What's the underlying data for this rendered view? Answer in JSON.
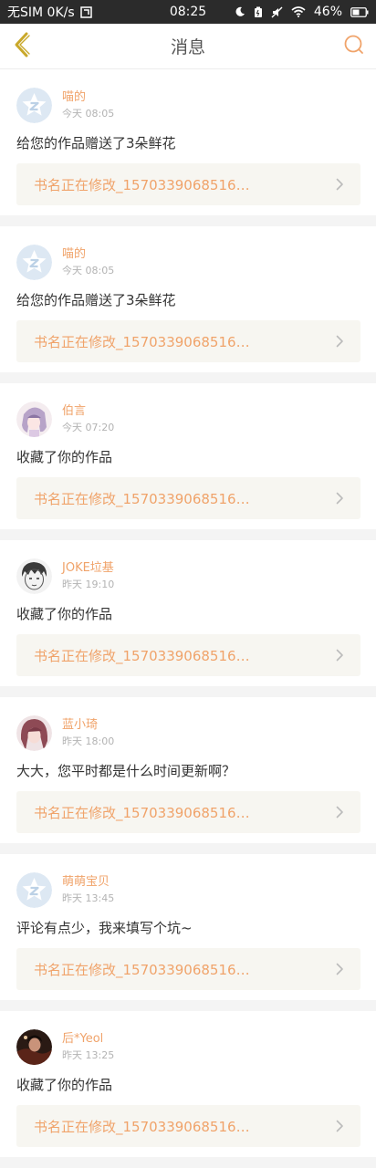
{
  "status_bar": {
    "carrier": "无SIM 0K/s",
    "time": "08:25",
    "battery": "46%"
  },
  "header": {
    "title": "消息",
    "back_icon": "chevron-left-icon",
    "search_icon": "search-icon"
  },
  "colors": {
    "accent": "#f0a36a",
    "back_icon": "#c9a82a",
    "book_bg": "#f7f6f1"
  },
  "messages": [
    {
      "user": "喵的",
      "time": "今天 08:05",
      "text": "给您的作品赠送了3朵鲜花",
      "book": "书名正在修改_1570339068516…",
      "avatar": "default-avatar"
    },
    {
      "user": "喵的",
      "time": "今天 08:05",
      "text": "给您的作品赠送了3朵鲜花",
      "book": "书名正在修改_1570339068516…",
      "avatar": "default-avatar"
    },
    {
      "user": "伯言",
      "time": "今天 07:20",
      "text": "收藏了你的作品",
      "book": "书名正在修改_1570339068516…",
      "avatar": "anime-girl-avatar"
    },
    {
      "user": "JOKE垃基",
      "time": "昨天 19:10",
      "text": "收藏了你的作品",
      "book": "书名正在修改_1570339068516…",
      "avatar": "sketch-boy-avatar"
    },
    {
      "user": "蓝小琦",
      "time": "昨天 18:00",
      "text": "大大，您平时都是什么时间更新啊？",
      "book": "书名正在修改_1570339068516…",
      "avatar": "anime-girl-red-avatar"
    },
    {
      "user": "萌萌宝贝",
      "time": "昨天 13:45",
      "text": "评论有点少，我来填写个坑~",
      "book": "书名正在修改_1570339068516…",
      "avatar": "default-avatar"
    },
    {
      "user": "后*Yeol",
      "time": "昨天 13:25",
      "text": "收藏了你的作品",
      "book": "书名正在修改_1570339068516…",
      "avatar": "dark-photo-avatar"
    }
  ]
}
